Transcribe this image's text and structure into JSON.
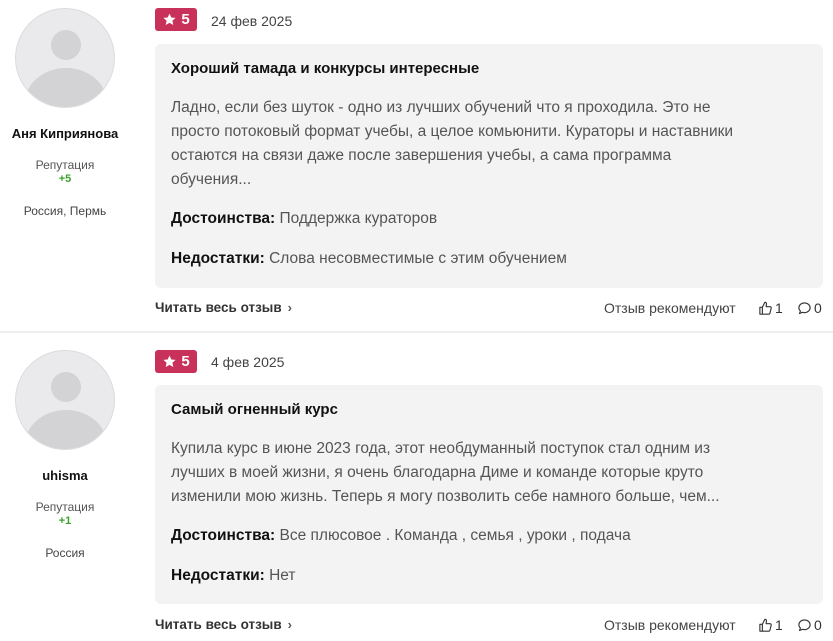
{
  "reviews": [
    {
      "author": {
        "name": "Аня Киприянова",
        "reputation_label": "Репутация",
        "reputation": "+5",
        "location": "Россия, Пермь"
      },
      "rating": "5",
      "date": "24 фев 2025",
      "title": "Хороший тамада и конкурсы интересные",
      "text_lines": [
        "Ладно, если без шуток - одно из лучших обучений что я проходила. Это не",
        "просто потоковый формат учебы, а целое комьюнити. Кураторы и наставники",
        "остаются на связи даже после завершения учебы, а сама программа",
        "обучения..."
      ],
      "pros_label": "Достоинства:",
      "pros": "Поддержка кураторов",
      "cons_label": "Недостатки:",
      "cons": "Слова несовместимые с этим обучением",
      "read_more": "Читать весь отзыв",
      "recommend_label": "Отзыв рекомендуют",
      "likes": "1",
      "comments": "0"
    },
    {
      "author": {
        "name": "uhisma",
        "reputation_label": "Репутация",
        "reputation": "+1",
        "location": "Россия"
      },
      "rating": "5",
      "date": "4 фев 2025",
      "title": "Самый огненный курс",
      "text_lines": [
        "Купила курс в июне 2023 года, этот необдуманный поступок стал одним из",
        "лучших в моей жизни, я очень благодарна Диме и команде которые круто",
        "изменили мою жизнь. Теперь я могу позволить себе намного больше, чем..."
      ],
      "pros_label": "Достоинства:",
      "pros": "Все плюсовое . Команда , семья , уроки , подача",
      "cons_label": "Недостатки:",
      "cons": "Нет",
      "read_more": "Читать весь отзыв",
      "recommend_label": "Отзыв рекомендуют",
      "likes": "1",
      "comments": "0"
    }
  ],
  "icons": {
    "rating": "star-icon",
    "read_more": "chevron-right-icon",
    "likes": "thumbs-up-icon",
    "comments": "comment-icon",
    "avatar": "user-avatar-placeholder"
  },
  "colors": {
    "rating_badge": "#c8325a",
    "reputation_positive": "#3aa32b",
    "card_background": "#f3f3f3"
  }
}
